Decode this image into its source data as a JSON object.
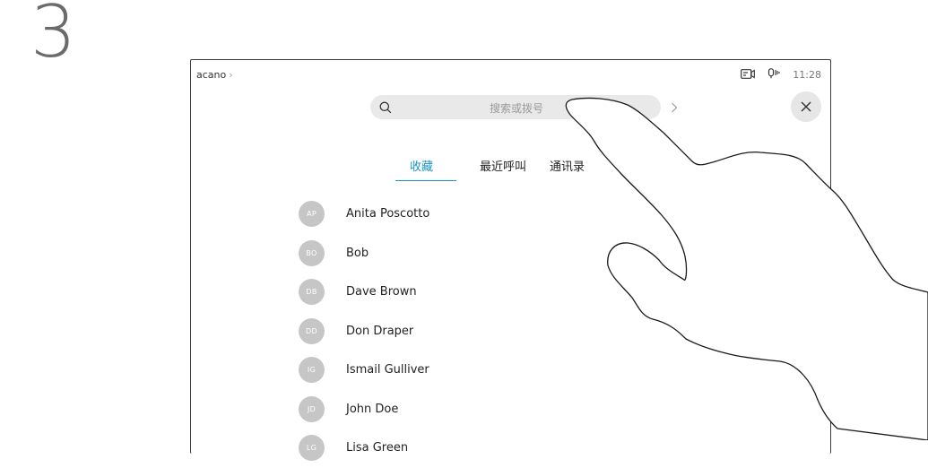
{
  "step_number": "3",
  "status_bar": {
    "breadcrumb": "acano",
    "breadcrumb_chevron": "›",
    "time": "11:28",
    "icons": [
      "camera-icon",
      "microphone-icon"
    ]
  },
  "search": {
    "placeholder": "搜索或拨号",
    "value": "",
    "go_symbol": "›"
  },
  "close_icon": "close-icon",
  "tabs": [
    {
      "label": "收藏",
      "active": true
    },
    {
      "label": "最近呼叫",
      "active": false
    },
    {
      "label": "通讯录",
      "active": false
    }
  ],
  "contacts": [
    {
      "initials": "AP",
      "name": "Anita Poscotto"
    },
    {
      "initials": "BO",
      "name": "Bob"
    },
    {
      "initials": "DB",
      "name": "Dave Brown"
    },
    {
      "initials": "DD",
      "name": "Don Draper"
    },
    {
      "initials": "IG",
      "name": "Ismail Gulliver"
    },
    {
      "initials": "JD",
      "name": "John Doe"
    },
    {
      "initials": "LG",
      "name": "Lisa Green"
    }
  ],
  "colors": {
    "accent": "#1b94c5",
    "avatar_bg": "#c6c6c6",
    "search_bg": "#e9e9e9"
  }
}
